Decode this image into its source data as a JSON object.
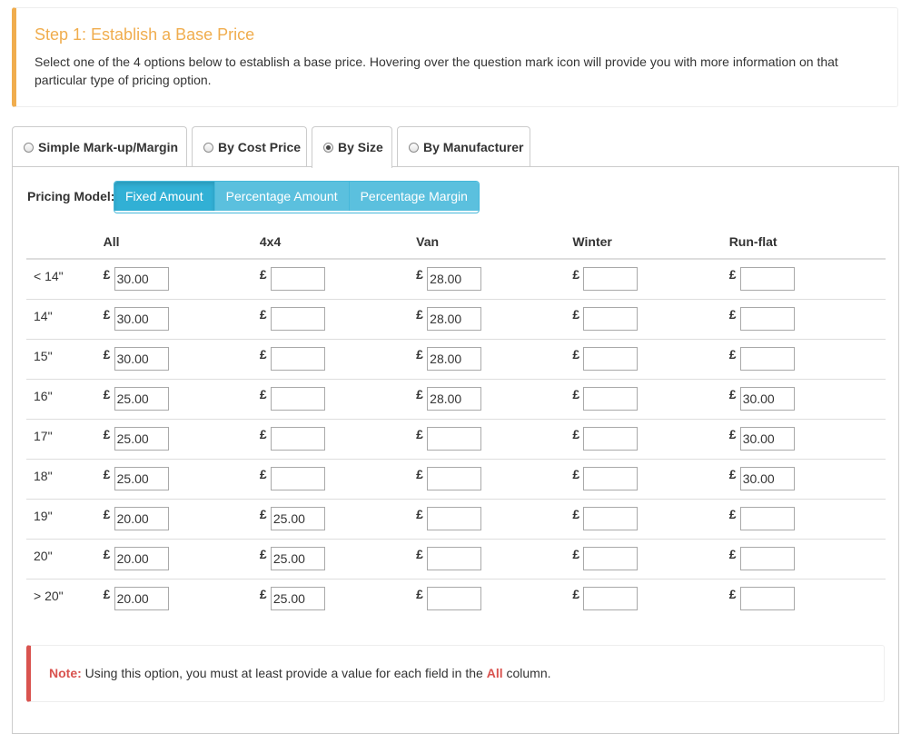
{
  "step": {
    "title": "Step 1: Establish a Base Price",
    "description": "Select one of the 4 options below to establish a base price. Hovering over the question mark icon will provide you with more information on that particular type of pricing option."
  },
  "tabs": [
    {
      "label": "Simple Mark-up/Margin",
      "selected": false
    },
    {
      "label": "By Cost Price",
      "selected": false
    },
    {
      "label": "By Size",
      "selected": true
    },
    {
      "label": "By Manufacturer",
      "selected": false
    }
  ],
  "pricing_model": {
    "label": "Pricing Model:",
    "options": [
      "Fixed Amount",
      "Percentage Amount",
      "Percentage Margin"
    ],
    "selected": "Fixed Amount"
  },
  "table": {
    "currency_symbol": "£",
    "columns": [
      "All",
      "4x4",
      "Van",
      "Winter",
      "Run-flat"
    ],
    "rows": [
      {
        "size": "< 14\"",
        "values": [
          "30.00",
          "",
          "28.00",
          "",
          ""
        ]
      },
      {
        "size": "14\"",
        "values": [
          "30.00",
          "",
          "28.00",
          "",
          ""
        ]
      },
      {
        "size": "15\"",
        "values": [
          "30.00",
          "",
          "28.00",
          "",
          ""
        ]
      },
      {
        "size": "16\"",
        "values": [
          "25.00",
          "",
          "28.00",
          "",
          "30.00"
        ]
      },
      {
        "size": "17\"",
        "values": [
          "25.00",
          "",
          "",
          "",
          "30.00"
        ]
      },
      {
        "size": "18\"",
        "values": [
          "25.00",
          "",
          "",
          "",
          "30.00"
        ]
      },
      {
        "size": "19\"",
        "values": [
          "20.00",
          "25.00",
          "",
          "",
          ""
        ]
      },
      {
        "size": "20\"",
        "values": [
          "20.00",
          "25.00",
          "",
          "",
          ""
        ]
      },
      {
        "size": "> 20\"",
        "values": [
          "20.00",
          "25.00",
          "",
          "",
          ""
        ]
      }
    ]
  },
  "note": {
    "lead": "Note:",
    "text_before": " Using this option, you must at least provide a value for each field in the ",
    "highlight": "All",
    "text_after": " column."
  },
  "colors": {
    "warning": "#f0ad4e",
    "danger": "#d9534f",
    "info": "#5bc0de"
  }
}
